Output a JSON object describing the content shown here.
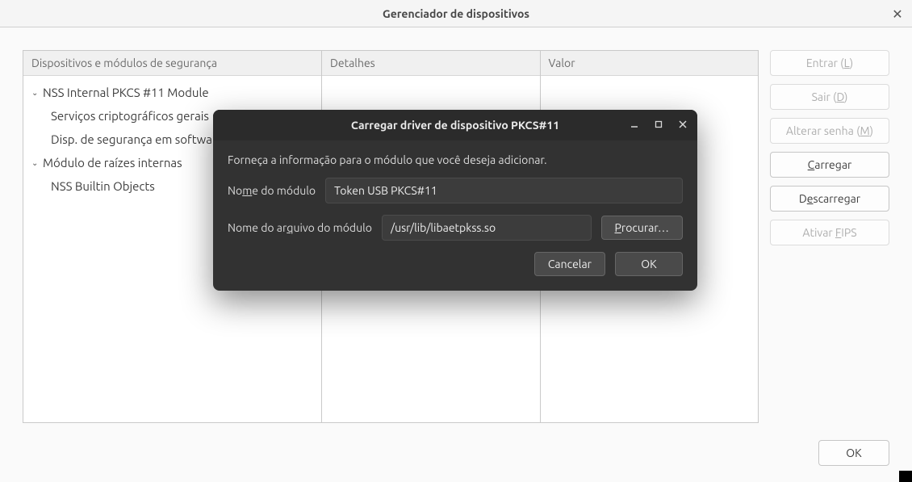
{
  "window": {
    "title": "Gerenciador de dispositivos"
  },
  "columns": {
    "devices": "Dispositivos e módulos de segurança",
    "details": "Detalhes",
    "value": "Valor"
  },
  "tree": {
    "module1": {
      "label": "NSS Internal PKCS #11 Module",
      "child1": "Serviços criptográficos gerais",
      "child2": "Disp. de segurança em software"
    },
    "module2": {
      "label": "Módulo de raízes internas",
      "child1": "NSS Builtin Objects"
    }
  },
  "buttons": {
    "login_pre": "Entrar (",
    "login_mn": "L",
    "login_post": ")",
    "logout_pre": "Sair (",
    "logout_mn": "D",
    "logout_post": ")",
    "changepw_pre": "Alterar senha (",
    "changepw_mn": "M",
    "changepw_post": ")",
    "load_mn": "C",
    "load_post": "arregar",
    "unload_pre": "D",
    "unload_mn": "e",
    "unload_post": "scarregar",
    "fips_pre": "Ativar ",
    "fips_mn": "F",
    "fips_post": "IPS",
    "ok": "OK"
  },
  "modal": {
    "title": "Carregar driver de dispositivo PKCS#11",
    "instruction": "Forneça a informação para o módulo que você deseja adicionar.",
    "name_label_pre": "No",
    "name_label_mn": "m",
    "name_label_post": "e do módulo",
    "name_value": "Token USB PKCS#11",
    "file_label_pre": "Nome do ar",
    "file_label_mn": "q",
    "file_label_post": "uivo do módulo",
    "file_value": "/usr/lib/libaetpkss.so",
    "browse_mn": "P",
    "browse_post": "rocurar…",
    "cancel": "Cancelar",
    "ok": "OK"
  }
}
